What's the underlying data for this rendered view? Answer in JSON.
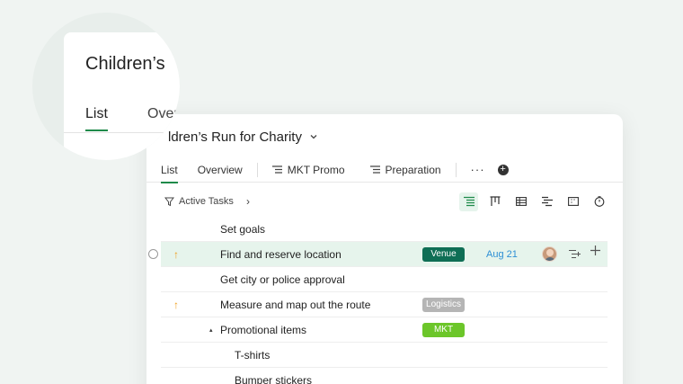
{
  "magnifier": {
    "title": "Children’s",
    "tabs": [
      "List",
      "Over"
    ]
  },
  "project": {
    "title": "ldren’s Run for Charity"
  },
  "tabs": [
    {
      "label": "List"
    },
    {
      "label": "Overview"
    },
    {
      "label": "MKT Promo"
    },
    {
      "label": "Preparation"
    }
  ],
  "more_label": "···",
  "add_label": "+",
  "filter": {
    "label": "Active Tasks",
    "arrow": "›"
  },
  "views": [
    "list-view-icon",
    "board-view-icon",
    "table-view-icon",
    "gantt-view-icon",
    "calendar-view-icon",
    "time-icon"
  ],
  "tasks": [
    {
      "name": "Set goals"
    },
    {
      "name": "Find and reserve location",
      "tag": "Venue",
      "date": "Aug 21",
      "priority": "↑"
    },
    {
      "name": "Get city or police approval"
    },
    {
      "name": "Measure and map out the route",
      "tag": "Logistics",
      "priority": "↑"
    },
    {
      "name": "Promotional items",
      "tag": "MKT",
      "caret": "▴"
    },
    {
      "name": "T-shirts"
    },
    {
      "name": "Bumper stickers"
    }
  ],
  "tag_colors": {
    "Venue": "#0f6e55",
    "Logistics": "#b5b5b5",
    "MKT": "#6cc62a"
  },
  "accent_color": "#1f8a4a"
}
